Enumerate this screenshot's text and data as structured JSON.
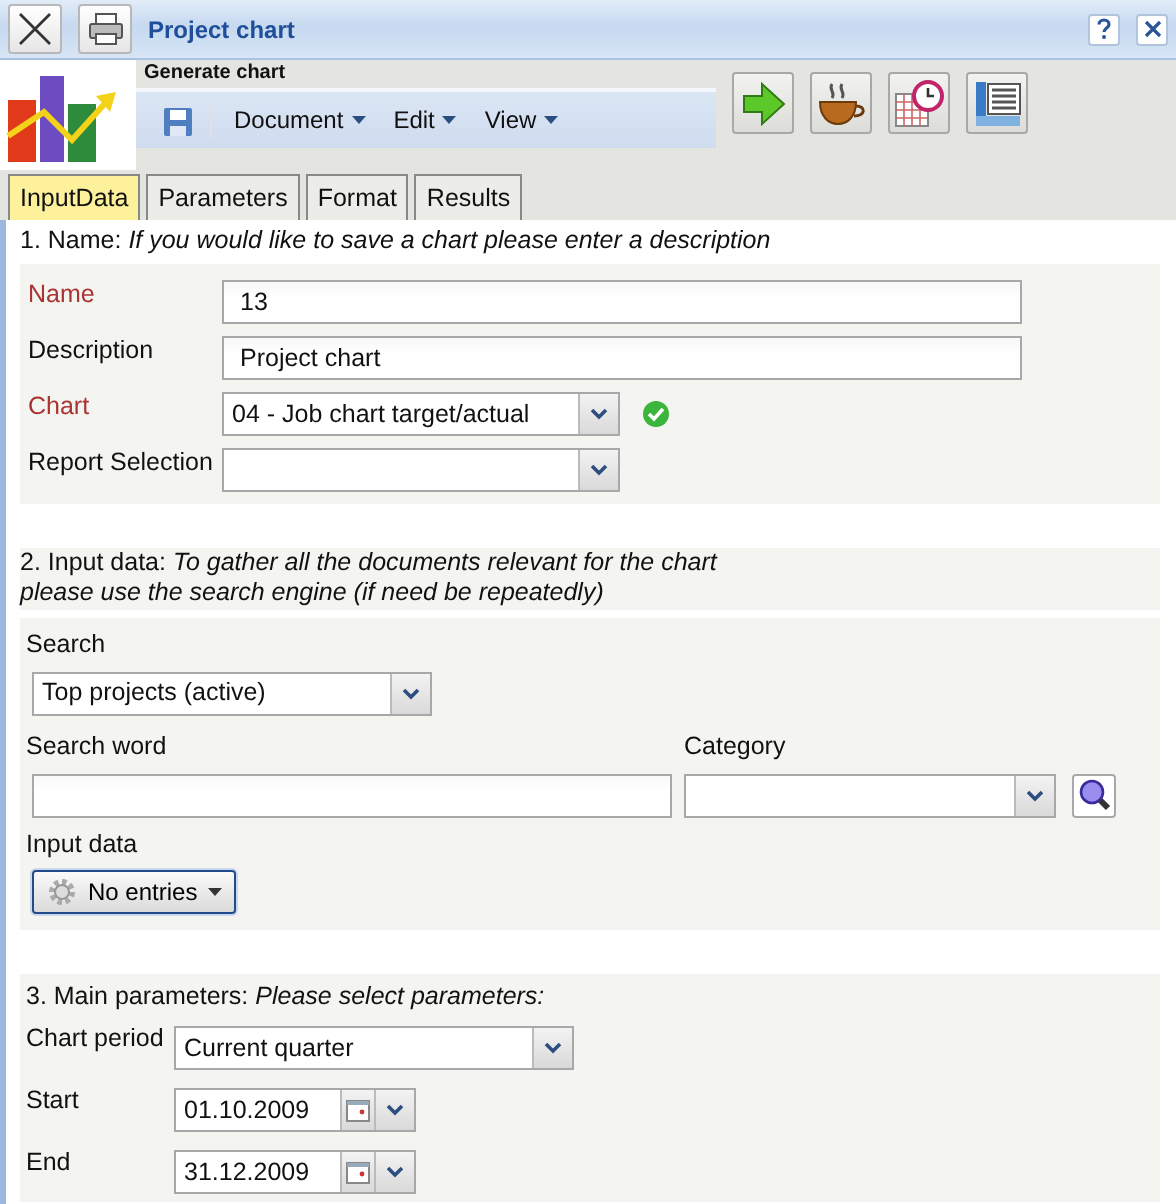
{
  "window": {
    "title": "Project chart"
  },
  "header": {
    "title": "Generate chart",
    "menus": [
      {
        "label": "Document"
      },
      {
        "label": "Edit"
      },
      {
        "label": "View"
      }
    ]
  },
  "tabs": [
    {
      "label": "InputData",
      "selected": true
    },
    {
      "label": "Parameters",
      "selected": false
    },
    {
      "label": "Format",
      "selected": false
    },
    {
      "label": "Results",
      "selected": false
    }
  ],
  "section_1": {
    "heading": "1. Name: *If you would like to save a chart please enter a description*",
    "fields": [
      {
        "label": "Name",
        "required": true,
        "kind": "text",
        "value": "13"
      },
      {
        "label": "Description",
        "required": false,
        "kind": "text",
        "value": "Project chart"
      },
      {
        "label": "Chart",
        "required": true,
        "kind": "select",
        "value": "04 - Job chart target/actual",
        "valid": true
      },
      {
        "label": "Report Selection",
        "required": false,
        "kind": "select",
        "valid": false
      }
    ]
  },
  "section_2": {
    "heading": "2. Input data: *To gather all the documents relevant for the chart*\n*please use the search engine (if need be repeatedly)*",
    "search": {
      "label": "Search",
      "value": "Top projects (active)"
    },
    "search_word": {
      "label": "Search word"
    },
    "category": {
      "label": "Category"
    },
    "input_data": {
      "label": "Input data",
      "button": "No entries"
    }
  },
  "section_3": {
    "heading": "3. Main parameters: *Please select parameters:*",
    "fields": [
      {
        "label": "Chart period",
        "kind": "select",
        "value": "Current quarter"
      },
      {
        "label": "Start",
        "kind": "date",
        "value": "01.10.2009"
      },
      {
        "label": "End",
        "kind": "date",
        "value": "31.12.2009"
      }
    ]
  }
}
